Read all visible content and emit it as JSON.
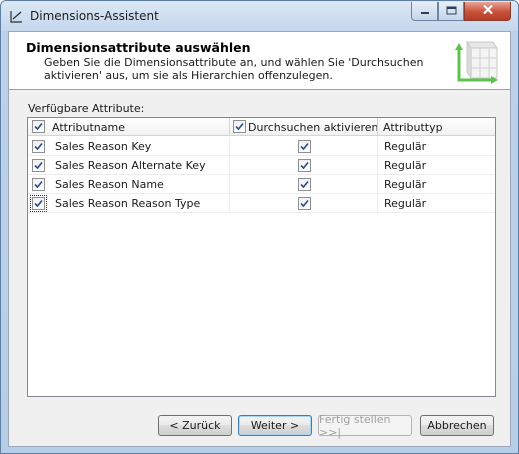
{
  "window": {
    "title": "Dimensions-Assistent",
    "controls": [
      "minimize-icon",
      "maximize-icon",
      "close-icon"
    ]
  },
  "header": {
    "title": "Dimensionsattribute auswählen",
    "description": "Geben Sie die Dimensionsattribute an, und wählen Sie 'Durchsuchen aktivieren' aus, um sie als Hierarchien offenzulegen."
  },
  "list_label": "Verfügbare Attribute:",
  "grid": {
    "columns": {
      "name": "Attributname",
      "browse": "Durchsuchen  aktivieren",
      "type": "Attributtyp"
    },
    "header_checked": {
      "name": true,
      "browse": true
    },
    "rows": [
      {
        "selected": true,
        "name": "Sales Reason Key",
        "browse": true,
        "type": "Regulär"
      },
      {
        "selected": true,
        "name": "Sales Reason Alternate Key",
        "browse": true,
        "type": "Regulär"
      },
      {
        "selected": true,
        "name": "Sales Reason Name",
        "browse": true,
        "type": "Regulär"
      },
      {
        "selected": true,
        "name": "Sales Reason Reason Type",
        "browse": true,
        "type": "Regulär"
      }
    ]
  },
  "buttons": {
    "back": "< Zurück",
    "next": "Weiter >",
    "finish": "Fertig stellen >>|",
    "cancel": "Abbrechen"
  },
  "colors": {
    "frame": "#b7cee8",
    "close_button": "#c8513b",
    "check": "#2a4f8a"
  }
}
